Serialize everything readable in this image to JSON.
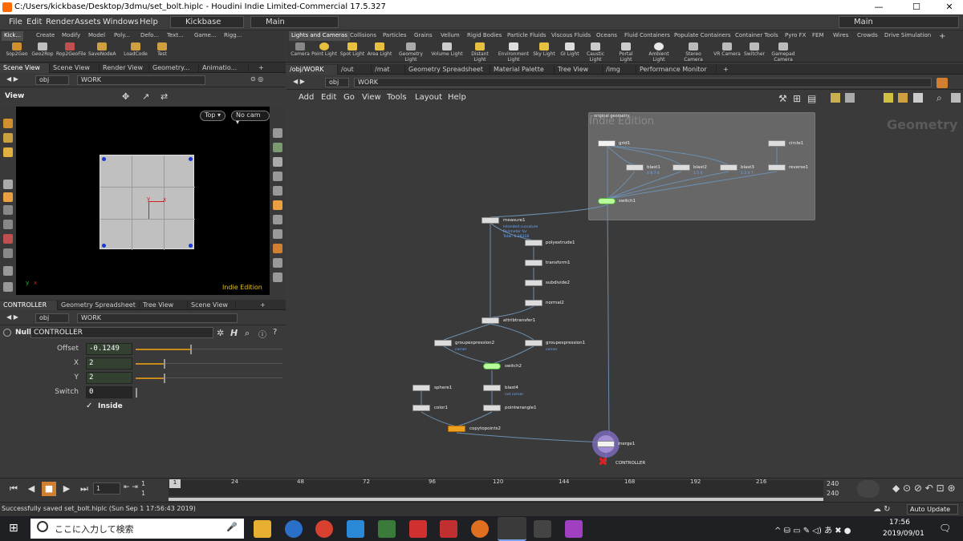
{
  "window": {
    "title": "C:/Users/kickbase/Desktop/3dmu/set_bolt.hiplc - Houdini Indie Limited-Commercial 17.5.327",
    "controls": [
      "—",
      "☐",
      "✕"
    ]
  },
  "menubar": {
    "items": [
      "File",
      "Edit",
      "Render",
      "Assets",
      "Windows",
      "Help"
    ],
    "desktop_left": "Kickbase",
    "desktop_mid": "Main",
    "desktop_right": "Main"
  },
  "shelf_left": {
    "tabs": [
      "Kick...",
      "Create",
      "Modify",
      "Model",
      "Poly...",
      "Defo...",
      "Text...",
      "Game...",
      "Rigg..."
    ],
    "tools": [
      "Sop2Geo",
      "Geo2Rop",
      "Rop2GeoFile",
      "SaveNodeA",
      "LoadCode",
      "Test"
    ]
  },
  "shelf_right": {
    "tabs": [
      "Lights and Cameras",
      "Collisions",
      "Particles",
      "Grains",
      "Vellum",
      "Rigid Bodies",
      "Particle Fluids",
      "Viscous Fluids",
      "Oceans",
      "Fluid Containers",
      "Populate Containers",
      "Container Tools",
      "Pyro FX",
      "FEM",
      "Wires",
      "Crowds",
      "Drive Simulation"
    ],
    "tools": [
      "Camera",
      "Point Light",
      "Spot Light",
      "Area Light",
      "Geometry Light",
      "Volume Light",
      "Distant Light",
      "Environment Light",
      "Sky Light",
      "GI Light",
      "Caustic Light",
      "Portal Light",
      "Ambient Light",
      "Stereo Camera",
      "VR Camera",
      "Switcher",
      "Gamepad Camera"
    ]
  },
  "scene_pane": {
    "tabs": [
      "Scene View",
      "Scene View",
      "Render View",
      "Geometry...",
      "Animatio..."
    ],
    "path_obj": "obj",
    "path_work": "WORK",
    "view_label": "View",
    "cam_top": "Top",
    "cam_nocam": "No cam",
    "watermark": "Indie Edition",
    "axis_x": "x",
    "axis_y": "y"
  },
  "param_pane": {
    "tabs": [
      "CONTROLLER",
      "Geometry Spreadsheet",
      "Tree View",
      "Scene View"
    ],
    "path_obj": "obj",
    "path_work": "WORK",
    "node_type": "Null",
    "node_name": "CONTROLLER",
    "params": [
      {
        "label": "Offset",
        "value": "-0.1249",
        "fraction": 0.37
      },
      {
        "label": "X",
        "value": "2",
        "fraction": 0.19
      },
      {
        "label": "Y",
        "value": "2",
        "fraction": 0.19
      },
      {
        "label": "Switch",
        "value": "0",
        "fraction": 0.0
      }
    ],
    "inside_label": "Inside"
  },
  "network_pane": {
    "tabs": [
      "/obj/WORK",
      "/out",
      "/mat",
      "Geometry Spreadsheet",
      "Material Palette",
      "Tree View",
      "/img",
      "Performance Monitor"
    ],
    "path_obj": "obj",
    "path_work": "WORK",
    "menu": [
      "Add",
      "Edit",
      "Go",
      "View",
      "Tools",
      "Layout",
      "Help"
    ],
    "watermark_edition": "Indie Edition",
    "context_label": "Geometry",
    "box_title": "original geometry",
    "nodes": [
      {
        "name": "grid1",
        "sub": ""
      },
      {
        "name": "circle1",
        "sub": ""
      },
      {
        "name": "blast1",
        "sub": "4 8 7 6"
      },
      {
        "name": "blast2",
        "sub": "1 5 6"
      },
      {
        "name": "blast3",
        "sub": "1 2 4 7"
      },
      {
        "name": "reverse1",
        "sub": ""
      },
      {
        "name": "switch1",
        "sub": ""
      },
      {
        "name": "measure1",
        "sub": "Intended curvature\nPerimeter for\nTotal: 6.28318"
      },
      {
        "name": "polyextrude1",
        "sub": ""
      },
      {
        "name": "transform1",
        "sub": ""
      },
      {
        "name": "subdivide2",
        "sub": ""
      },
      {
        "name": "normal2",
        "sub": ""
      },
      {
        "name": "attribtransfer1",
        "sub": ""
      },
      {
        "name": "groupexpression2",
        "sub": "corner"
      },
      {
        "name": "groupexpression1",
        "sub": "corner"
      },
      {
        "name": "switch2",
        "sub": ""
      },
      {
        "name": "sphere1",
        "sub": ""
      },
      {
        "name": "blast4",
        "sub": "not corner"
      },
      {
        "name": "color1",
        "sub": ""
      },
      {
        "name": "pointwrangle1",
        "sub": ""
      },
      {
        "name": "copytopoints2",
        "sub": ""
      },
      {
        "name": "merge1",
        "sub": ""
      },
      {
        "name": "CONTROLLER",
        "sub": ""
      }
    ]
  },
  "timeline": {
    "current_frame": "1",
    "start": "1",
    "start2": "1",
    "frame_marker": "1",
    "ticks": [
      "24",
      "48",
      "72",
      "96",
      "120",
      "144",
      "168",
      "192",
      "216"
    ],
    "end": "240",
    "end2": "240",
    "auto_update": "Auto Update"
  },
  "status": {
    "message": "Successfully saved set_bolt.hiplc (Sun Sep  1 17:56:43 2019)"
  },
  "taskbar": {
    "search_placeholder": "ここに入力して検索",
    "time": "17:56",
    "date": "2019/09/01"
  }
}
